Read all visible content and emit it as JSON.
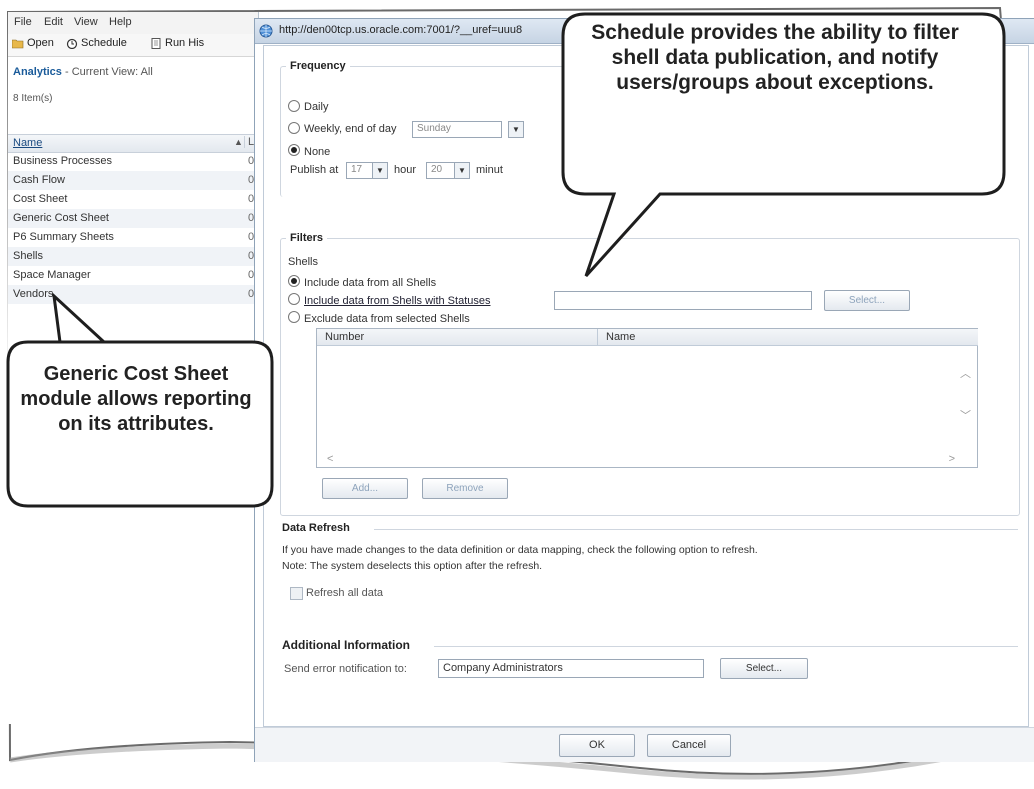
{
  "left_app": {
    "menu": [
      "File",
      "Edit",
      "View",
      "Help"
    ],
    "toolbar": {
      "open": "Open",
      "schedule": "Schedule",
      "run": "Run His"
    },
    "breadcrumb": {
      "module": "Analytics",
      "view": " - Current View:  All"
    },
    "item_count": "8  Item(s)",
    "grid": {
      "header_name": "Name",
      "header_sort": "▲",
      "header_col2": "L",
      "rows": [
        {
          "name": "Business Processes",
          "c2": "0"
        },
        {
          "name": "Cash Flow",
          "c2": "0"
        },
        {
          "name": "Cost Sheet",
          "c2": "0"
        },
        {
          "name": "Generic Cost Sheet",
          "c2": "0"
        },
        {
          "name": "P6 Summary Sheets",
          "c2": "0"
        },
        {
          "name": "Shells",
          "c2": "0"
        },
        {
          "name": "Space Manager",
          "c2": "0"
        },
        {
          "name": "Vendors",
          "c2": "0"
        }
      ]
    }
  },
  "dialog": {
    "url": "http://den00tcp.us.oracle.com:7001/?__uref=uuu8",
    "frequency": {
      "title": "Frequency",
      "daily": "Daily",
      "weekly": "Weekly,  end of day",
      "weekly_day": "Sunday",
      "none": "None",
      "publish_at": "Publish at",
      "hour_value": "17",
      "hour_label": "hour",
      "minute_value": "20",
      "minute_label": "minut"
    },
    "filters": {
      "title": "Filters",
      "shells_label": "Shells",
      "opt_all": "Include data from all Shells",
      "opt_status": "Include data from Shells with Statuses",
      "opt_exclude": "Exclude data from selected Shells",
      "select_button": "Select...",
      "table_headers": [
        "Number",
        "Name"
      ],
      "add_button": "Add...",
      "remove_button": "Remove"
    },
    "refresh": {
      "title": "Data Refresh",
      "text1": "If you have made changes to the data definition or data mapping, check the following option to refresh.",
      "text2": "Note: The system deselects this option after the refresh.",
      "checkbox_label": "Refresh  all data"
    },
    "additional": {
      "title": "Additional  Information",
      "label": "Send error notification to:",
      "value": "Company Administrators",
      "select_button": "Select..."
    },
    "ok": "OK",
    "cancel": "Cancel"
  },
  "callouts": {
    "schedule": "Schedule provides the ability to filter shell data publication, and notify users/groups about exceptions.",
    "generic": "Generic Cost Sheet module allows reporting on its attributes."
  }
}
